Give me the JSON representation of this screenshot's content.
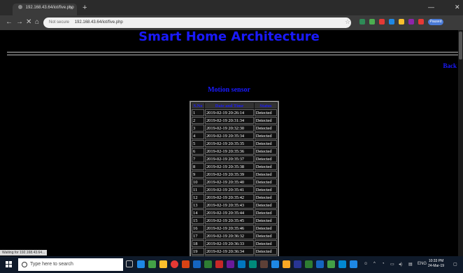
{
  "browser": {
    "tab_title": "192.168.43.64/iot/five.php",
    "new_tab": "+",
    "url_security": "Not secure",
    "url": "192.168.43.64/iot/five.php",
    "back_glyph": "←",
    "forward_glyph": "→",
    "stop_glyph": "✕",
    "home_glyph": "⌂",
    "star_glyph": "☆",
    "profile_label": "Paused",
    "min_glyph": "—",
    "close_glyph": "✕",
    "status_text": "Waiting for 192.168.43.64..."
  },
  "page": {
    "title": "Smart Home Architecture",
    "back_link": "Back",
    "section_caption": "Motion sensor",
    "table": {
      "headers": [
        "S.No",
        "Date and Time",
        "Status"
      ],
      "rows": [
        [
          "1",
          "2019-02-19 20:26:14",
          "Detected"
        ],
        [
          "2",
          "2019-02-19 20:31:34",
          "Detected"
        ],
        [
          "3",
          "2019-02-19 20:32:30",
          "Detected"
        ],
        [
          "4",
          "2019-02-19 20:35:34",
          "Detected"
        ],
        [
          "5",
          "2019-02-19 20:35:35",
          "Detected"
        ],
        [
          "6",
          "2019-02-19 20:35:36",
          "Detected"
        ],
        [
          "7",
          "2019-02-19 20:35:37",
          "Detected"
        ],
        [
          "8",
          "2019-02-19 20:35:38",
          "Detected"
        ],
        [
          "9",
          "2019-02-19 20:35:39",
          "Detected"
        ],
        [
          "10",
          "2019-02-19 20:35:40",
          "Detected"
        ],
        [
          "11",
          "2019-02-19 20:35:41",
          "Detected"
        ],
        [
          "12",
          "2019-02-19 20:35:42",
          "Detected"
        ],
        [
          "13",
          "2019-02-19 20:35:43",
          "Detected"
        ],
        [
          "14",
          "2019-02-19 20:35:44",
          "Detected"
        ],
        [
          "15",
          "2019-02-19 20:35:45",
          "Detected"
        ],
        [
          "16",
          "2019-02-19 20:35:46",
          "Detected"
        ],
        [
          "17",
          "2019-02-19 20:36:32",
          "Detected"
        ],
        [
          "18",
          "2019-02-19 20:36:33",
          "Detected"
        ],
        [
          "19",
          "2019-02-19 20:36:34",
          "Detected"
        ],
        [
          "20",
          "2019-02-19 20:36:35",
          "Detected"
        ]
      ]
    }
  },
  "taskbar": {
    "search_placeholder": "Type here to search",
    "language": "ENG",
    "time": "10:33 PM",
    "date": "24-Mar-19"
  },
  "colors": {
    "heading_blue": "#1a1aff",
    "page_background": "#000000",
    "taskbar": "#0f1a2a"
  }
}
